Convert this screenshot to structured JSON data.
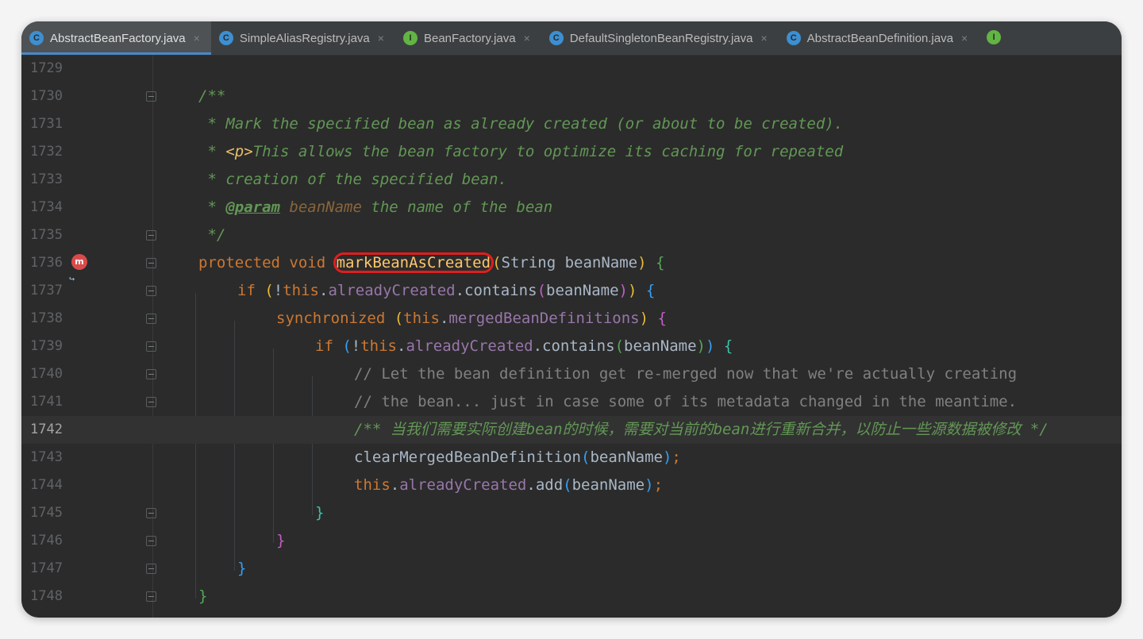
{
  "tabs": [
    {
      "name": "AbstractBeanFactory.java",
      "icon": "class-icon",
      "active": true
    },
    {
      "name": "SimpleAliasRegistry.java",
      "icon": "class-icon",
      "active": false
    },
    {
      "name": "BeanFactory.java",
      "icon": "interface-icon",
      "active": false
    },
    {
      "name": "DefaultSingletonBeanRegistry.java",
      "icon": "class-icon",
      "active": false
    },
    {
      "name": "AbstractBeanDefinition.java",
      "icon": "class-icon",
      "active": false
    }
  ],
  "tab_close_glyph": "×",
  "tab_icon_letters": {
    "class": "C",
    "interface": "I"
  },
  "breakpoint_glyph": "m",
  "line_numbers": [
    "1729",
    "1730",
    "1731",
    "1732",
    "1733",
    "1734",
    "1735",
    "1736",
    "1737",
    "1738",
    "1739",
    "1740",
    "1741",
    "1742",
    "1743",
    "1744",
    "1745",
    "1746",
    "1747",
    "1748"
  ],
  "current_line": "1742",
  "colors": {
    "background": "#2b2b2b",
    "tab_active_underline": "#4a88c7",
    "highlight_box": "#e01e1e",
    "doc_comment": "#629755",
    "keyword": "#cc7832",
    "method": "#ffc66d",
    "field": "#9876aa"
  },
  "code": {
    "l1730": {
      "t1": "/**"
    },
    "l1731": {
      "t1": " * Mark the specified bean as already created (or about to be created)."
    },
    "l1732": {
      "t1": " * ",
      "t2": "<p>",
      "t3": "This allows the bean factory to optimize its caching for repeated"
    },
    "l1733": {
      "t1": " * creation of the specified bean."
    },
    "l1734": {
      "t1": " * ",
      "t2": "@param",
      "t3": " ",
      "t4": "beanName",
      "t5": " the name of the bean"
    },
    "l1735": {
      "t1": " */"
    },
    "l1736": {
      "t1": "protected void ",
      "t2": "markBeanAsCreated",
      "t3": "(",
      "t4": "String beanName",
      "t5": ")",
      "t6": " {"
    },
    "l1737": {
      "t1": "if ",
      "t2": "(",
      "t3": "!",
      "t4": "this",
      "t5": ".",
      "t6": "alreadyCreated",
      "t7": ".contains",
      "t8": "(",
      "t9": "beanName",
      "t10": ")",
      "t11": ")",
      "t12": " {"
    },
    "l1738": {
      "t1": "synchronized ",
      "t2": "(",
      "t3": "this",
      "t4": ".",
      "t5": "mergedBeanDefinitions",
      "t6": ")",
      "t7": " {"
    },
    "l1739": {
      "t1": "if ",
      "t2": "(",
      "t3": "!",
      "t4": "this",
      "t5": ".",
      "t6": "alreadyCreated",
      "t7": ".contains",
      "t8": "(",
      "t9": "beanName",
      "t10": ")",
      "t11": ")",
      "t12": " {"
    },
    "l1740": {
      "t1": "// Let the bean definition get re-merged now that we're actually creating"
    },
    "l1741": {
      "t1": "// the bean... just in case some of its metadata changed in the meantime."
    },
    "l1742": {
      "t1": "/** ",
      "t2": "当我们需要实际创建",
      "t3": "bean",
      "t4": "的时候，需要对当前的",
      "t5": "bean",
      "t6": "进行重新合并，以防止一些源数据被修改",
      "t7": " */"
    },
    "l1743": {
      "t1": "clearMergedBeanDefinition",
      "t2": "(",
      "t3": "beanName",
      "t4": ")",
      "t5": ";"
    },
    "l1744": {
      "t1": "this",
      "t2": ".",
      "t3": "alreadyCreated",
      "t4": ".add",
      "t5": "(",
      "t6": "beanName",
      "t7": ")",
      "t8": ";"
    },
    "l1745": {
      "t1": "}"
    },
    "l1746": {
      "t1": "}"
    },
    "l1747": {
      "t1": "}"
    },
    "l1748": {
      "t1": "}"
    }
  }
}
